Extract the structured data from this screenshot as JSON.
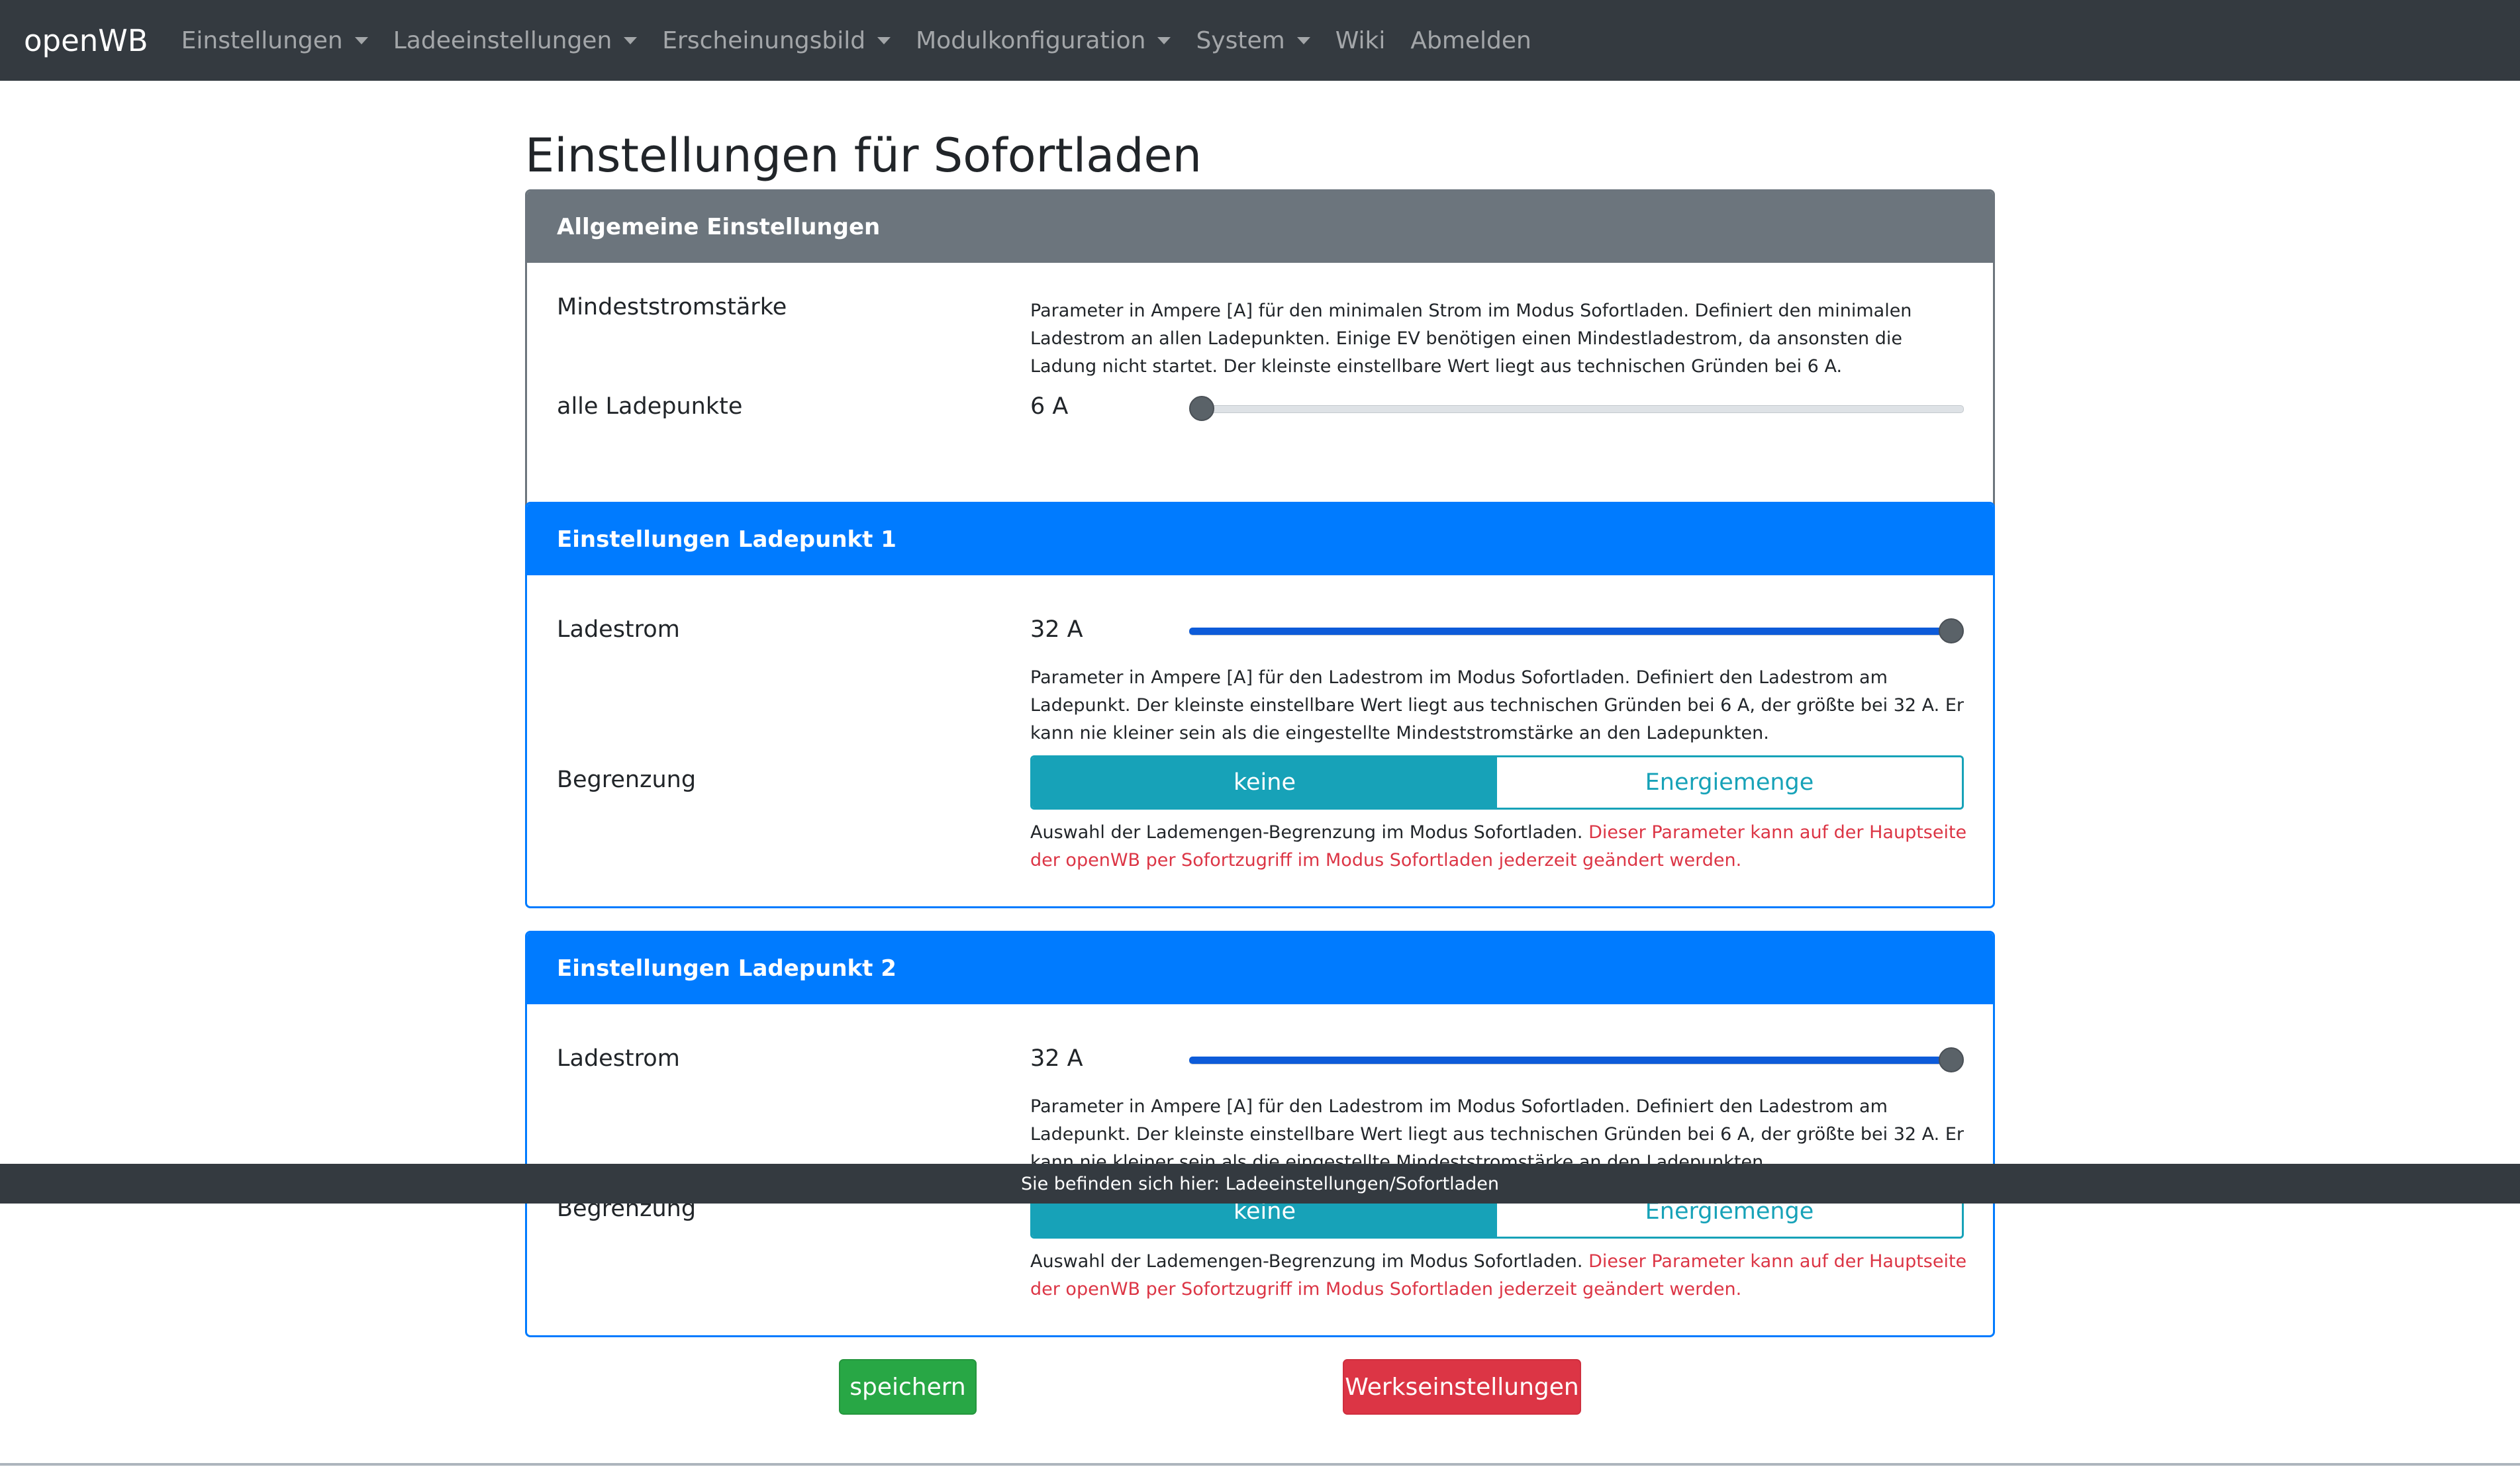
{
  "navbar": {
    "brand": "openWB",
    "items": [
      {
        "label": "Einstellungen",
        "dropdown": true
      },
      {
        "label": "Ladeeinstellungen",
        "dropdown": true
      },
      {
        "label": "Erscheinungsbild",
        "dropdown": true
      },
      {
        "label": "Modulkonfiguration",
        "dropdown": true
      },
      {
        "label": "System",
        "dropdown": true
      },
      {
        "label": "Wiki",
        "dropdown": false
      },
      {
        "label": "Abmelden",
        "dropdown": false
      }
    ]
  },
  "page": {
    "title": "Einstellungen für Sofortladen"
  },
  "general": {
    "header": "Allgemeine Einstellungen",
    "min_current_label": "Mindeststromstärke",
    "min_current_help": "Parameter in Ampere [A] für den minimalen Strom im Modus Sofortladen. Definiert den minimalen Ladestrom an allen Ladepunkten. Einige EV benötigen einen Mindestladestrom, da ansonsten die Ladung nicht startet. Der kleinste einstellbare Wert liegt aus technischen Gründen bei 6 A.",
    "all_points_label": "alle Ladepunkte",
    "all_points_value": "6 A",
    "all_points_fraction": 0.0
  },
  "lp1": {
    "header": "Einstellungen Ladepunkt 1",
    "current_label": "Ladestrom",
    "current_value": "32 A",
    "current_fraction": 1.0,
    "current_help": "Parameter in Ampere [A] für den Ladestrom im Modus Sofortladen. Definiert den Ladestrom am Ladepunkt. Der kleinste einstellbare Wert liegt aus technischen Gründen bei 6 A, der größte bei 32 A. Er kann nie kleiner sein als die eingestellte Mindeststromstärke an den Ladepunkten.",
    "limit_label": "Begrenzung",
    "limit_options": [
      "keine",
      "Energiemenge"
    ],
    "limit_selected": "keine",
    "limit_help": "Auswahl der Lademengen-Begrenzung im Modus Sofortladen.",
    "limit_help_danger": "Dieser Parameter kann auf der Hauptseite der openWB per Sofortzugriff im Modus Sofortladen jederzeit geändert werden."
  },
  "lp2": {
    "header": "Einstellungen Ladepunkt 2",
    "current_label": "Ladestrom",
    "current_value": "32 A",
    "current_fraction": 1.0,
    "current_help": "Parameter in Ampere [A] für den Ladestrom im Modus Sofortladen. Definiert den Ladestrom am Ladepunkt. Der kleinste einstellbare Wert liegt aus technischen Gründen bei 6 A, der größte bei 32 A. Er kann nie kleiner sein als die eingestellte Mindeststromstärke an den Ladepunkten.",
    "limit_label": "Begrenzung",
    "limit_options": [
      "keine",
      "Energiemenge"
    ],
    "limit_selected": "keine",
    "limit_help": "Auswahl der Lademengen-Begrenzung im Modus Sofortladen.",
    "limit_help_danger": "Dieser Parameter kann auf der Hauptseite der openWB per Sofortzugriff im Modus Sofortladen jederzeit geändert werden."
  },
  "breadcrumb_bar": {
    "text": "Sie befinden sich hier: Ladeeinstellungen/Sofortladen"
  },
  "actions": {
    "save_label": "speichern",
    "reset_label": "Werkseinstellungen"
  },
  "colors": {
    "navbar": "#343a40",
    "secondary": "#6c757d",
    "primary": "#007bff",
    "info": "#17a2b8",
    "success": "#28a745",
    "danger": "#dc3545"
  }
}
